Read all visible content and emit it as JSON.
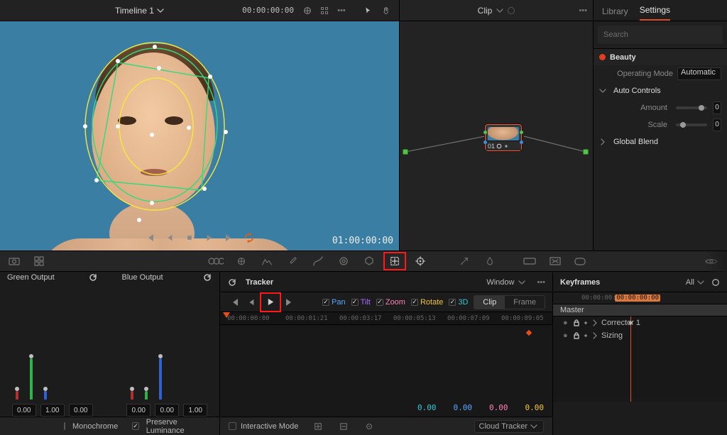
{
  "viewer": {
    "title": "Timeline 1",
    "timecode_small": "00:00:00:00",
    "timecode_big": "01:00:00:00"
  },
  "pointer_icons": [
    "selection-dropdown",
    "fit-icon",
    "more-icon",
    "arrow-cursor",
    "hand-cursor"
  ],
  "node_panel": {
    "label": "Clip"
  },
  "node": {
    "number": "01"
  },
  "inspector": {
    "tabs": {
      "library": "Library",
      "settings": "Settings"
    },
    "search_placeholder": "Search",
    "beauty_label": "Beauty",
    "operating_mode_label": "Operating Mode",
    "operating_mode_value": "Automatic",
    "auto_controls_label": "Auto Controls",
    "amount_label": "Amount",
    "amount_edge": "0",
    "scale_label": "Scale",
    "scale_edge": "0",
    "global_blend_label": "Global Blend"
  },
  "curves": {
    "green_label": "Green Output",
    "blue_label": "Blue Output",
    "green_vals": [
      "0.00",
      "1.00",
      "0.00"
    ],
    "blue_vals": [
      "0.00",
      "0.00",
      "1.00"
    ],
    "monochrome": "Monochrome",
    "preserve": "Preserve Luminance"
  },
  "tracker": {
    "title": "Tracker",
    "mode_label": "Window",
    "pan": "Pan",
    "tilt": "Tilt",
    "zoom": "Zoom",
    "rotate": "Rotate",
    "3d": "3D",
    "clip": "Clip",
    "frame": "Frame",
    "ruler": [
      "00:00:00:00",
      "00:00:01:21",
      "00:00:03:17",
      "00:00:05:13",
      "00:00:07:09",
      "00:00:09:05"
    ],
    "vals": {
      "pan": "0.00",
      "tilt": "0.00",
      "zoom": "0.00",
      "rot": "0.00"
    },
    "interactive": "Interactive Mode",
    "method": "Cloud Tracker"
  },
  "keyframes": {
    "title": "Keyframes",
    "filter": "All",
    "tc": "00:00:00:00",
    "rulertc": "00:00:00:00",
    "master": "Master",
    "rows": [
      "Corrector 1",
      "Sizing"
    ]
  }
}
